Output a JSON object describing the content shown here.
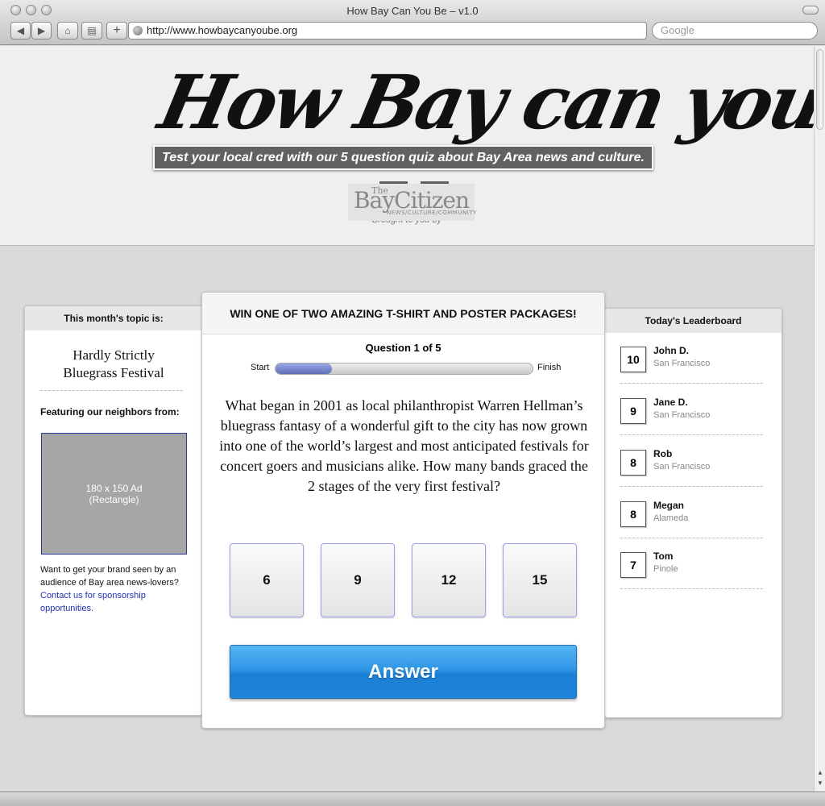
{
  "browser": {
    "window_title": "How Bay Can You Be – v1.0",
    "url": "http://www.howbaycanyoube.org",
    "search_placeholder": "Google"
  },
  "header": {
    "logo_text": "How Bay can you be?",
    "tagline": "Test your local cred with our 5 question quiz about Bay Area news and culture.",
    "facebook_glyph": "f",
    "twitter_glyph": "t",
    "brought_by": "Brought to you by",
    "sponsor": {
      "the": "The",
      "name": "BayCitizen",
      "sub": "NEWS/CULTURE/COMMUNITY"
    }
  },
  "left_panel": {
    "heading": "This month's topic is:",
    "topic_line1": "Hardly Strictly",
    "topic_line2": "Bluegrass Festival",
    "featuring": "Featuring our neighbors from:",
    "ad_line1": "180 x 150 Ad",
    "ad_line2": "(Rectangle)",
    "sponsor_text": "Want to get your brand seen by an audience of Bay area news-lovers?",
    "sponsor_link": "Contact us for sponsorship opportunities."
  },
  "quiz": {
    "banner": "WIN ONE OF TWO AMAZING T-SHIRT AND POSTER PACKAGES!",
    "question_counter": "Question 1 of 5",
    "progress_start": "Start",
    "progress_finish": "Finish",
    "progress": 0.22,
    "question": "What began in 2001 as local philanthropist Warren Hellman’s bluegrass fantasy of a wonderful gift to the city has now grown into one of the world’s largest and most anticipated festivals for concert goers and musicians alike. How many bands graced the 2 stages of the very first festival?",
    "choices": [
      "6",
      "9",
      "12",
      "15"
    ],
    "answer_label": "Answer"
  },
  "leaderboard": {
    "heading": "Today's Leaderboard",
    "entries": [
      {
        "score": "10",
        "name": "John D.",
        "location": "San Francisco"
      },
      {
        "score": "9",
        "name": "Jane D.",
        "location": "San Francisco"
      },
      {
        "score": "8",
        "name": "Rob",
        "location": "San Francisco"
      },
      {
        "score": "8",
        "name": "Megan",
        "location": "Alameda"
      },
      {
        "score": "7",
        "name": "Tom",
        "location": "Pinole"
      }
    ]
  },
  "colors": {
    "accent_blue": "#2f96e6",
    "progress_fill": "#6f7fc6",
    "link": "#2233b0"
  }
}
